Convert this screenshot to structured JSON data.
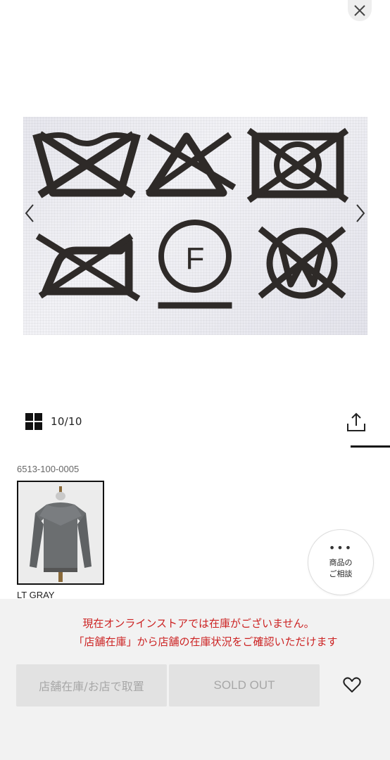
{
  "header": {
    "close_icon": "close-icon"
  },
  "gallery": {
    "image_alt": "care-label-symbols",
    "prev_icon": "chevron-left-icon",
    "next_icon": "chevron-right-icon",
    "care_label_letter": "F",
    "counter": "10/10",
    "grid_icon": "grid-icon",
    "share_icon": "share-icon"
  },
  "product": {
    "code": "6513-100-0005",
    "color_name": "LT GRAY"
  },
  "consult": {
    "dots": "•••",
    "label_line1": "商品の",
    "label_line2": "ご相談"
  },
  "stock": {
    "message_line1": "現在オンラインストアでは在庫がございません。",
    "message_line2": "「店舗在庫」から店舗の在庫状況をご確認いただけます",
    "message_color": "#cc2222"
  },
  "actions": {
    "store_button": "店舗在庫/お店で取置",
    "soldout_button": "SOLD OUT",
    "favorite_icon": "heart-icon"
  }
}
